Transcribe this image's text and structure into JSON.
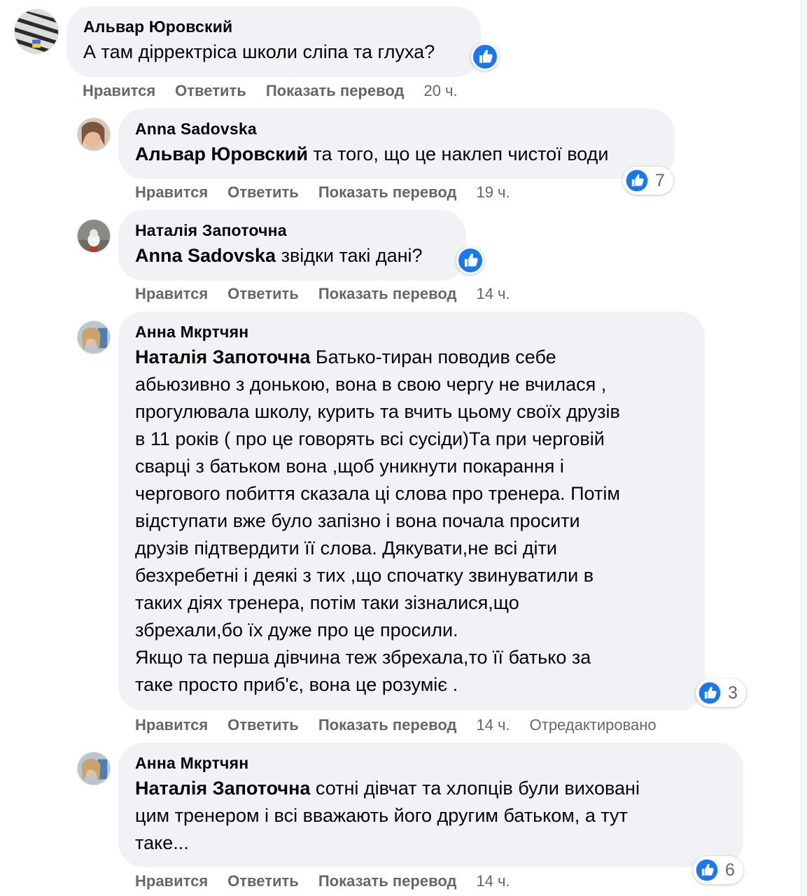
{
  "actions": {
    "like": "Нравится",
    "reply": "Ответить",
    "translate": "Показать перевод"
  },
  "colors": {
    "bubble_bg": "#f0f2f5",
    "meta_text": "#65676b",
    "like_blue": "#1877f2"
  },
  "comments": [
    {
      "author": "Альвар Юровский",
      "mention": "",
      "text": "А там дірректріса школи сліпа та глуха?",
      "time": "20 ч.",
      "edited": "",
      "reaction_icon": "like-icon",
      "reaction_count": ""
    },
    {
      "author": "Anna Sadovska",
      "mention": "Альвар Юровский",
      "text": " та того, що це наклеп чистої води",
      "time": "19 ч.",
      "edited": "",
      "reaction_icon": "like-icon",
      "reaction_count": "7"
    },
    {
      "author": "Наталія Запоточна",
      "mention": "Anna Sadovska",
      "text": " звідки такі дані?",
      "time": "14 ч.",
      "edited": "",
      "reaction_icon": "like-icon",
      "reaction_count": ""
    },
    {
      "author": "Анна Мкртчян",
      "mention": "Наталія Запоточна",
      "text": " Батько-тиран поводив себе\nабьюзивно з донькою, вона в свою чергу не вчилася ,\nпрогулювала школу, курить та вчить цьому своїх друзів\nв 11 років ( про це говорять всі сусіди)Та при черговій\nсварці з батьком вона ,щоб уникнути покарання і\nчергового побиття сказала ці слова про тренера. Потім\nвідступати вже було запізно і вона почала просити\nдрузів підтвердити її слова. Дякувати,не всі діти\nбезхребетні і деякі з тих ,що спочатку звинуватили в\nтаких діях тренера, потім таки зізналися,що\nзбрехали,бо їх дуже про це просили.\nЯкщо та перша дівчина теж збрехала,то її батько за\nтаке просто приб'є, вона це розуміє .",
      "time": "14 ч.",
      "edited": "Отредактировано",
      "reaction_icon": "like-icon",
      "reaction_count": "3"
    },
    {
      "author": "Анна Мкртчян",
      "mention": "Наталія Запоточна",
      "text": " сотні дівчат та хлопців були виховані\nцим тренером і всі вважають його другим батьком, а тут\nтаке...",
      "time": "14 ч.",
      "edited": "",
      "reaction_icon": "like-icon",
      "reaction_count": "6"
    }
  ]
}
